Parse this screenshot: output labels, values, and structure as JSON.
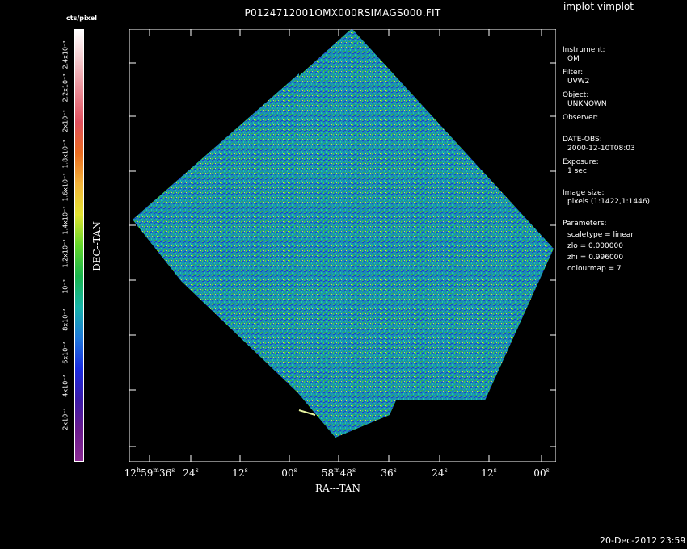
{
  "window": {
    "title": "implot vimplot"
  },
  "plot": {
    "title": "P0124712001OMX000RSIMAGS000.FIT",
    "x_axis_label": "RA---TAN",
    "y_axis_label": "DEC--TAN",
    "x_ticks": [
      {
        "main": "12",
        "h": "h",
        "m": "59",
        "mu": "m",
        "s": "36",
        "su": "s"
      },
      {
        "main": "24",
        "su": "s"
      },
      {
        "main": "12",
        "su": "s"
      },
      {
        "main": "00",
        "su": "s"
      },
      {
        "main": "58",
        "mu": "m",
        "s": "48",
        "su": "s"
      },
      {
        "main": "36",
        "su": "s"
      },
      {
        "main": "24",
        "su": "s"
      },
      {
        "main": "12",
        "su": "s"
      },
      {
        "main": "00",
        "su": "s"
      }
    ]
  },
  "colorbar": {
    "unit_label": "cts/pixel",
    "tick_labels": [
      "2.4x10⁻³",
      "2.2x10⁻³",
      "2x10⁻³",
      "1.8x10⁻³",
      "1.6x10⁻³",
      "1.4x10⁻³",
      "1.2x10⁻³",
      "10⁻³",
      "8x10⁻⁴",
      "6x10⁻⁴",
      "4x10⁻⁴",
      "2x10⁻⁴"
    ],
    "colourmap": [
      "#ffffff",
      "#f4c8cc",
      "#ea8a94",
      "#e0505e",
      "#e86b1f",
      "#f3b33a",
      "#e2e231",
      "#62d62a",
      "#19b44d",
      "#16b3a8",
      "#1e78d8",
      "#1a2ce0",
      "#3a1aa8",
      "#6a1a8c",
      "#8a2a92"
    ]
  },
  "info": {
    "instrument_label": "Instrument:",
    "instrument_value": "OM",
    "filter_label": "Filter:",
    "filter_value": "UVW2",
    "object_label": "Object:",
    "object_value": "UNKNOWN",
    "observer_label": "Observer:",
    "date_label": "DATE-OBS:",
    "date_value": "2000-12-10T08:03",
    "exposure_label": "Exposure:",
    "exposure_value": "1 sec",
    "image_size_label": "Image size:",
    "image_size_value": "pixels (1:1422,1:1446)",
    "parameters_label": "Parameters:",
    "param_scaletype": "scaletype = linear",
    "param_zlo": "zlo = 0.000000",
    "param_zhi": "zhi = 0.996000",
    "param_colourmap": "colourmap =    7"
  },
  "footer": {
    "timestamp": "20-Dec-2012 23:59"
  }
}
